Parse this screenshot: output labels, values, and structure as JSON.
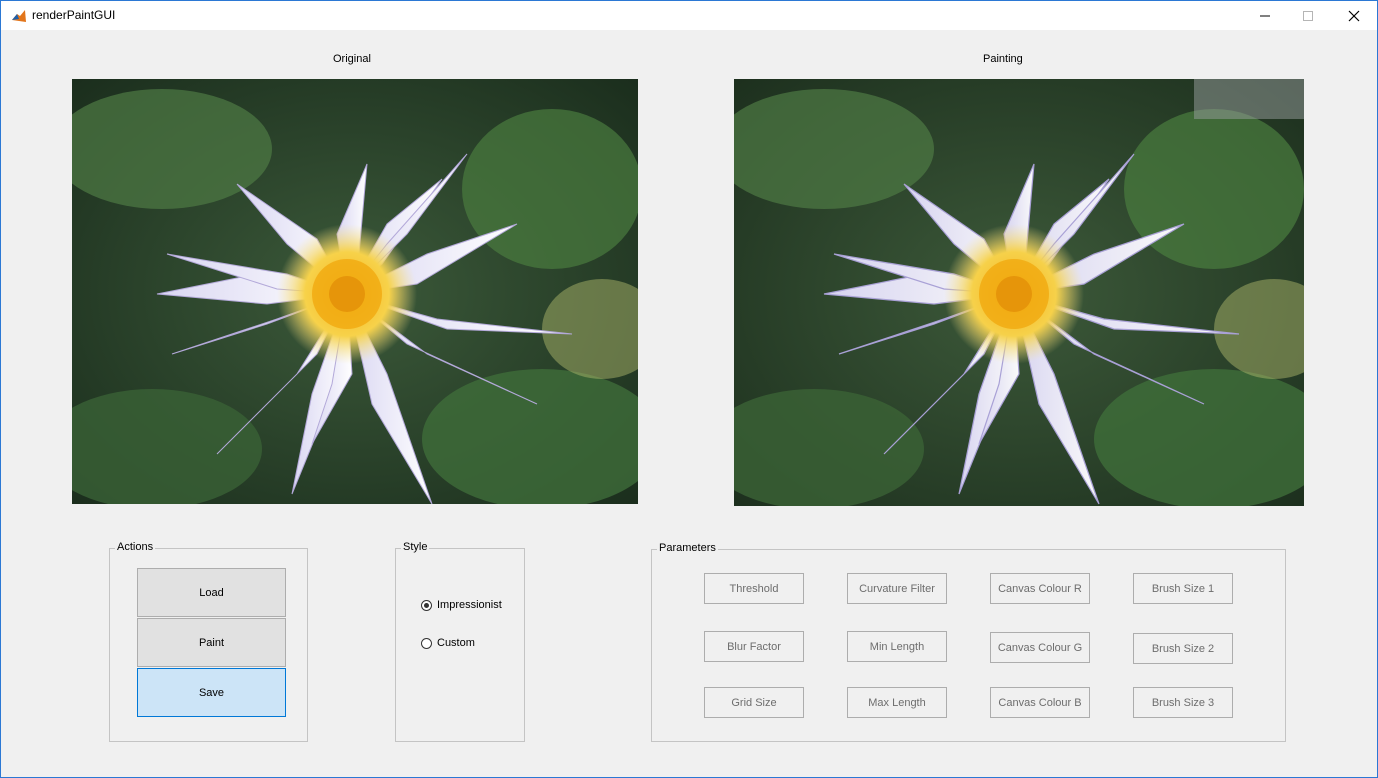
{
  "window": {
    "title": "renderPaintGUI",
    "icon": "matlab-icon"
  },
  "images": {
    "original_label": "Original",
    "painting_label": "Painting"
  },
  "actions": {
    "title": "Actions",
    "load": "Load",
    "paint": "Paint",
    "save": "Save"
  },
  "style": {
    "title": "Style",
    "options": [
      {
        "label": "Impressionist",
        "selected": true
      },
      {
        "label": "Custom",
        "selected": false
      }
    ]
  },
  "parameters": {
    "title": "Parameters",
    "buttons": [
      "Threshold",
      "Curvature Filter",
      "Canvas Colour R",
      "Brush Size 1",
      "Blur Factor",
      "Min Length",
      "Canvas Colour G",
      "Brush Size 2",
      "Grid Size",
      "Max Length",
      "Canvas Colour B",
      "Brush Size 3"
    ]
  }
}
